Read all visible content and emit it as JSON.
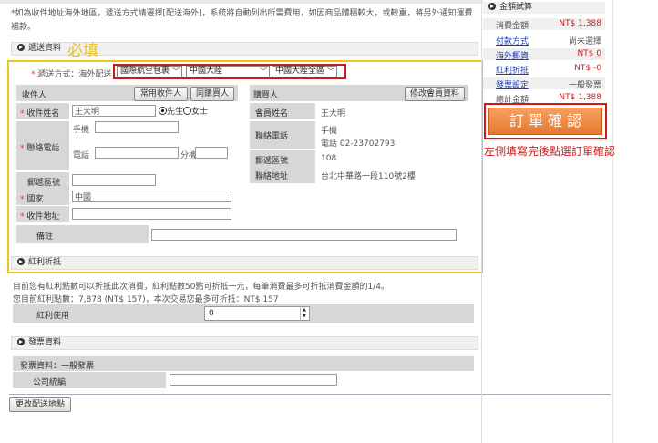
{
  "notice": {
    "line1": "*如為收件地址海外地區，遞送方式請選擇[配送海外]，系統將自動列出所需費用，如因商品體積較大，或較重，將另外通知運費",
    "line2": "補款。"
  },
  "shipping_section": {
    "title": "遞送資料",
    "required_mark": "必填",
    "method_label": "遞送方式：",
    "method_value_prefix": "海外配送",
    "select_carrier": "國際航空包裹",
    "select_country": "中國大陸",
    "select_region": "中國大陸全區"
  },
  "recipient": {
    "header": "收件人",
    "common_btn": "常用收件人",
    "same_btn": "同購買人",
    "name_label": "收件姓名",
    "name_value": "王大明",
    "gender_male": "先生",
    "gender_female": "女士",
    "phone_label": "聯絡電話",
    "mobile_label": "手機",
    "tel_label": "電話",
    "ext_label": "分機",
    "zip_label": "郵遞區號",
    "country_label": "國家",
    "country_value": "中國",
    "address_label": "收件地址",
    "remark_label": "備註"
  },
  "buyer": {
    "header": "購買人",
    "edit_btn": "修改會員資料",
    "name_label": "會員姓名",
    "name_value": "王大明",
    "phone_label": "聯絡電話",
    "mobile_label": "手機",
    "tel_value": "電話 02-23702793",
    "zip_label": "郵遞區號",
    "zip_value": "108",
    "address_label": "聯絡地址",
    "address_value": "台北中華路一段110號2樓"
  },
  "bonus_section": {
    "title": "紅利折抵",
    "note1": "目前您有紅利點數可以折抵此次消費，紅利點數50點可折抵一元，每筆消費最多可折抵消費金額的1/4。",
    "note2": "您目前紅利點數：7,878 (NT$ 157)，本次交易您最多可折抵：NT$ 157",
    "use_label": "紅利使用",
    "use_value": "0"
  },
  "invoice_section": {
    "title": "發票資料",
    "type_text": "發票資料：一般發票",
    "tax_id_label": "公司統編"
  },
  "edit_address_btn": "更改配送地點",
  "summary": {
    "title": "金額試算",
    "rows": [
      {
        "label": "消費金額",
        "value": "NT$ 1,388"
      },
      {
        "label": "付款方式",
        "value": "尚未選擇"
      },
      {
        "label": "海外郵資",
        "value": "NT$ 0"
      },
      {
        "label": "紅利折抵",
        "value": "NT$ -0"
      },
      {
        "label": "發票設定",
        "value": "一般發票"
      },
      {
        "label": "總計金額",
        "value": "NT$ 1,388"
      }
    ],
    "confirm_btn": "訂 單 確 認",
    "hint": "左側填寫完後點選訂單確認"
  },
  "colors": {
    "yellow_border": "#f2c21e",
    "red_annotation": "#d01818",
    "orange_button": "#f08a3c",
    "required_text": "#e8c21e"
  }
}
